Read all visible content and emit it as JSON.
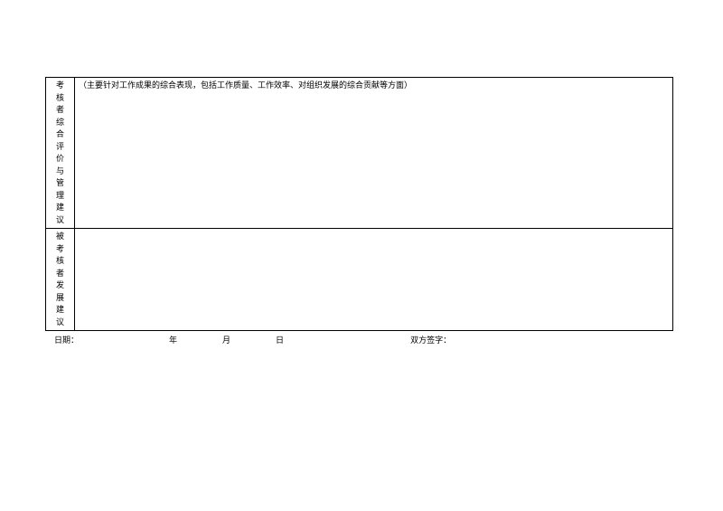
{
  "rows": {
    "evaluator": {
      "label_chars": [
        "考",
        "核",
        "者",
        "综",
        "合",
        "评",
        "价",
        "与",
        "管",
        "理",
        "建",
        "议"
      ],
      "hint": "（主要针对工作成果的综合表现，包括工作质量、工作效率、对组织发展的综合贡献等方面）"
    },
    "evaluatee": {
      "label_chars": [
        "被",
        "考",
        "核",
        "者",
        "发",
        "展",
        "建",
        "议"
      ],
      "content": ""
    }
  },
  "footer": {
    "date_label": "日期：",
    "year_label": "年",
    "month_label": "月",
    "day_label": "日",
    "sign_label": "双方签字："
  }
}
